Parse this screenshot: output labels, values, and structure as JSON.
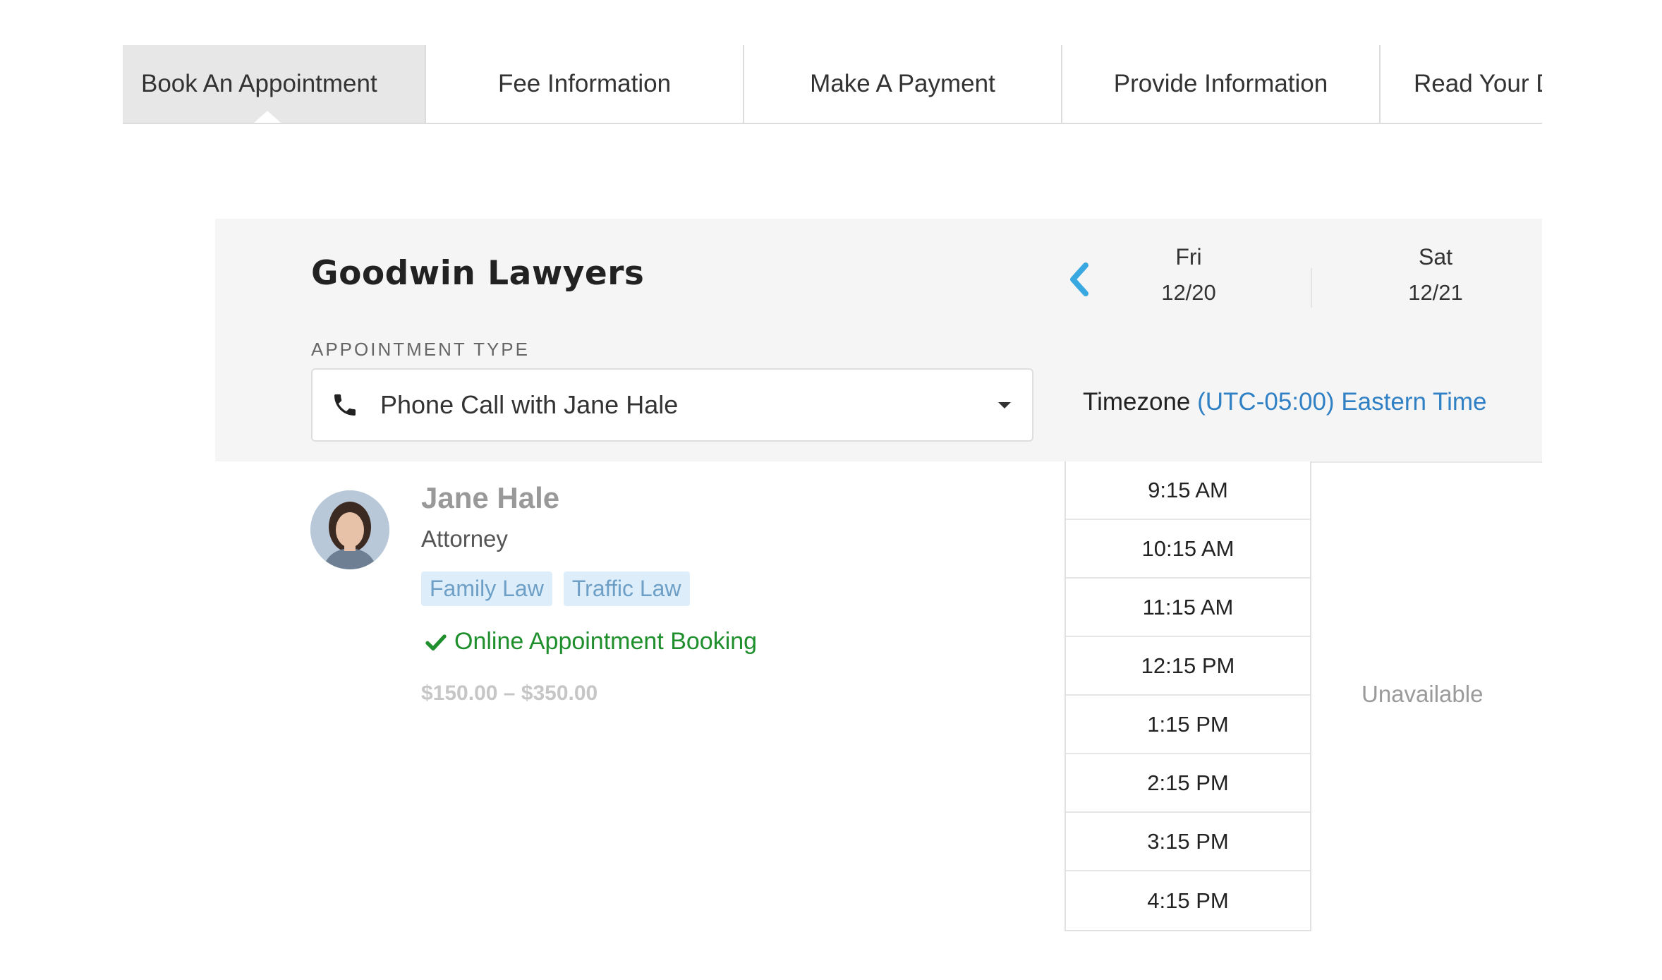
{
  "tabs": [
    {
      "label": "Book An Appointment",
      "active": true
    },
    {
      "label": "Fee Information",
      "active": false
    },
    {
      "label": "Make A Payment",
      "active": false
    },
    {
      "label": "Provide Information",
      "active": false
    },
    {
      "label": "Read Your D",
      "active": false
    }
  ],
  "firm": {
    "name": "Goodwin Lawyers"
  },
  "appointment": {
    "label": "APPOINTMENT TYPE",
    "selected": "Phone Call with Jane Hale",
    "icon": "phone-icon"
  },
  "calendar": {
    "days": [
      {
        "name": "Fri",
        "date": "12/20"
      },
      {
        "name": "Sat",
        "date": "12/21"
      }
    ],
    "timezone_label": "Timezone",
    "timezone_value": "(UTC-05:00) Eastern Time",
    "slots_fri": [
      "9:15 AM",
      "10:15 AM",
      "11:15 AM",
      "12:15 PM",
      "1:15 PM",
      "2:15 PM",
      "3:15 PM",
      "4:15 PM"
    ],
    "sat_status": "Unavailable"
  },
  "attorney": {
    "name": "Jane Hale",
    "role": "Attorney",
    "tags": [
      "Family Law",
      "Traffic Law"
    ],
    "booking": "Online Appointment Booking",
    "price": "$150.00 – $350.00"
  },
  "colors": {
    "accent": "#2f80c4",
    "chevron": "#3aa8e0",
    "success": "#1f8e2c",
    "tag_bg": "#ddeefa"
  }
}
